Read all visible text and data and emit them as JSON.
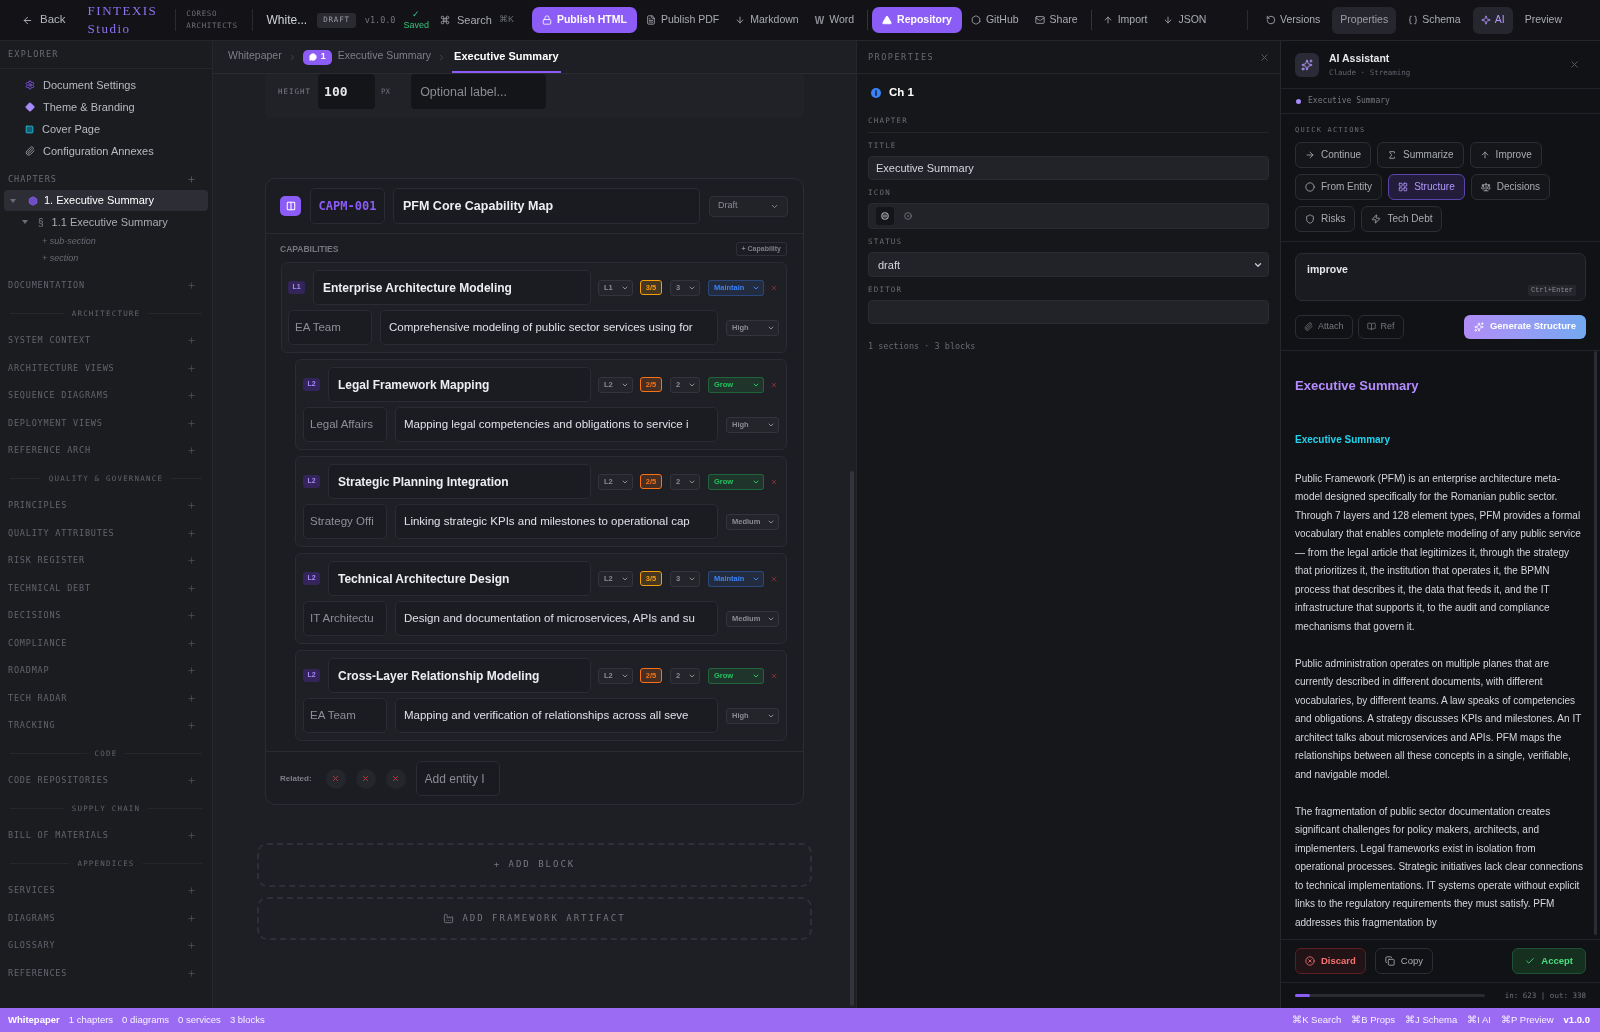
{
  "top_bar": {
    "back": "Back",
    "logo": {
      "line_1": "FINTEXIS",
      "line_2": "Studio"
    },
    "organization": {
      "line_1": "CORESO",
      "line_2": "ARCHITECTS"
    },
    "document": {
      "name": "White...",
      "status": "DRAFT",
      "version": "v1.0.0",
      "saved_mark": "✓",
      "saved": "Saved"
    },
    "search": {
      "label": "Search",
      "shortcut": "⌘K"
    },
    "actions": [
      {
        "kind": "primary",
        "label": "Publish HTML",
        "separator_before": false
      },
      {
        "kind": "plain",
        "label": "Publish PDF",
        "separator_before": false
      },
      {
        "kind": "plain",
        "label": "Markdown",
        "separator_before": false
      },
      {
        "kind": "plain",
        "glyph": "W",
        "label": "Word",
        "separator_before": false
      },
      {
        "kind": "primary",
        "label": "Repository",
        "separator_before": true
      },
      {
        "kind": "plain",
        "label": "GitHub",
        "separator_before": false
      },
      {
        "kind": "plain",
        "label": "Share",
        "separator_before": false
      },
      {
        "kind": "plain",
        "label": "Import",
        "separator_before": true
      },
      {
        "kind": "plain",
        "label": "JSON",
        "separator_before": false
      }
    ],
    "panels": [
      {
        "label": "Versions",
        "selected": false
      },
      {
        "label": "Properties",
        "selected": true
      },
      {
        "label": "Schema",
        "selected": false
      },
      {
        "label": "AI",
        "selected": true,
        "color": "#b197fc"
      },
      {
        "label": "Preview",
        "selected": false
      }
    ]
  },
  "sidebar": {
    "title": "EXPLORER",
    "document_items": [
      "Document Settings",
      "Theme & Branding",
      "Cover Page",
      "Configuration Annexes"
    ],
    "chapters": {
      "title": "CHAPTERS",
      "items": [
        {
          "label": "1. Executive Summary",
          "selected": true,
          "expanded": true,
          "children": [
            {
              "marker": "§",
              "label": "1.1 Executive Summary",
              "selected": false,
              "expanded": true
            }
          ]
        }
      ],
      "add_links": [
        "+ sub-section",
        "+ section"
      ]
    },
    "groups": [
      {
        "items": [
          "DOCUMENTATION"
        ]
      },
      {
        "heading": "ARCHITECTURE",
        "items": [
          "SYSTEM CONTEXT",
          "ARCHITECTURE VIEWS",
          "SEQUENCE DIAGRAMS",
          "DEPLOYMENT VIEWS",
          "REFERENCE ARCH"
        ]
      },
      {
        "heading": "QUALITY & GOVERNANCE",
        "items": [
          "PRINCIPLES",
          "QUALITY ATTRIBUTES",
          "RISK REGISTER",
          "TECHNICAL DEBT",
          "DECISIONS",
          "COMPLIANCE",
          "ROADMAP",
          "TECH RADAR",
          "TRACKING"
        ]
      },
      {
        "heading": "CODE",
        "items": [
          "CODE REPOSITORIES"
        ]
      },
      {
        "heading": "SUPPLY CHAIN",
        "items": [
          "BILL OF MATERIALS"
        ]
      },
      {
        "heading": "APPENDICES",
        "items": [
          "SERVICES",
          "DIAGRAMS",
          "GLOSSARY",
          "REFERENCES"
        ]
      }
    ]
  },
  "editor": {
    "breadcrumb": [
      {
        "label": "Whitepaper",
        "selected": false
      },
      {
        "badge": "1",
        "label": "Executive Summary",
        "selected": false
      },
      {
        "label": "Executive Summary",
        "selected": true
      }
    ],
    "height_block": {
      "label": "HEIGHT",
      "value": "100",
      "unit": "PX",
      "placeholder": "Optional label..."
    },
    "capability_map": {
      "id": "CAPM-001",
      "title": "PFM Core Capability Map",
      "status": "Draft",
      "section_label": "CAPABILITIES",
      "add_button": "+ Capability",
      "capabilities": [
        {
          "badge": "L1",
          "name": "Enterprise Architecture Modeling",
          "level": "L1",
          "maturity": {
            "value": "3/5",
            "color": "#f59e0b"
          },
          "target": "3",
          "strategy": {
            "value": "Maintain",
            "color": "#3b82f6"
          },
          "owner": "EA Team",
          "description": "Comprehensive modeling of public sector services using for",
          "priority": "High",
          "children": [
            {
              "badge": "L2",
              "name": "Legal Framework Mapping",
              "level": "L2",
              "maturity": {
                "value": "2/5",
                "color": "#f97316"
              },
              "target": "2",
              "strategy": {
                "value": "Grow",
                "color": "#22c55e"
              },
              "owner": "Legal Affairs",
              "description": "Mapping legal competencies and obligations to service i",
              "priority": "High"
            },
            {
              "badge": "L2",
              "name": "Strategic Planning Integration",
              "level": "L2",
              "maturity": {
                "value": "2/5",
                "color": "#f97316"
              },
              "target": "2",
              "strategy": {
                "value": "Grow",
                "color": "#22c55e"
              },
              "owner": "Strategy Offi",
              "description": "Linking strategic KPIs and milestones to operational cap",
              "priority": "Medium"
            },
            {
              "badge": "L2",
              "name": "Technical Architecture Design",
              "level": "L2",
              "maturity": {
                "value": "3/5",
                "color": "#f59e0b"
              },
              "target": "3",
              "strategy": {
                "value": "Maintain",
                "color": "#3b82f6"
              },
              "owner": "IT Architectu",
              "description": "Design and documentation of microservices, APIs and su",
              "priority": "Medium"
            },
            {
              "badge": "L2",
              "name": "Cross-Layer Relationship Modeling",
              "level": "L2",
              "maturity": {
                "value": "2/5",
                "color": "#f97316"
              },
              "target": "2",
              "strategy": {
                "value": "Grow",
                "color": "#22c55e"
              },
              "owner": "EA Team",
              "description": "Mapping and verification of relationships across all seve",
              "priority": "High"
            }
          ]
        }
      ],
      "related": {
        "label": "Related:",
        "items": [
          {
            "removable": true
          },
          {
            "removable": true
          },
          {
            "removable": true
          }
        ],
        "placeholder": "Add entity I"
      }
    },
    "add_block": "+ ADD BLOCK",
    "add_artifact": "ADD FRAMEWORK ARTIFACT"
  },
  "properties": {
    "title": "PROPERTIES",
    "heading": "Ch 1",
    "section": "CHAPTER",
    "fields": [
      {
        "kind": "text",
        "label": "TITLE",
        "value": "Executive Summary"
      },
      {
        "kind": "icon",
        "label": "ICON"
      },
      {
        "kind": "select",
        "label": "STATUS",
        "value": "draft"
      },
      {
        "kind": "text",
        "label": "EDITOR"
      }
    ],
    "summary": "1 sections · 3 blocks"
  },
  "ai_panel": {
    "title": "AI Assistant",
    "subtitle": "Claude · Streaming",
    "context": "Executive Summary",
    "quick_actions_label": "QUICK ACTIONS",
    "quick_actions": [
      {
        "label": "Continue",
        "selected": false
      },
      {
        "label": "Summarize",
        "selected": false
      },
      {
        "label": "Improve",
        "selected": false
      },
      {
        "label": "From Entity",
        "selected": false
      },
      {
        "label": "Structure",
        "selected": true
      },
      {
        "label": "Decisions",
        "selected": false
      },
      {
        "label": "Risks",
        "selected": false
      },
      {
        "label": "Tech Debt",
        "selected": false
      }
    ],
    "prompt": {
      "value": "improve",
      "hint": "Ctrl+Enter"
    },
    "attach": "Attach",
    "ref": "Ref",
    "generate": "Generate Structure",
    "output": {
      "title": "Executive Summary",
      "subtitle": "Executive Summary",
      "paragraphs": [
        "Public Framework (PFM) is an enterprise architecture meta-model designed specifically for the Romanian public sector. Through 7 layers and 128 element types, PFM provides a formal vocabulary that enables complete modeling of any public service — from the legal article that legitimizes it, through the strategy that prioritizes it, the institution that operates it, the BPMN process that describes it, the data that feeds it, and the IT infrastructure that supports it, to the audit and compliance mechanisms that govern it.",
        "Public administration operates on multiple planes that are currently described in different documents, with different vocabularies, by different teams. A law speaks of competencies and obligations. A strategy discusses KPIs and milestones. An IT architect talks about microservices and APIs. PFM maps the relationships between all these concepts in a single, verifiable, and navigable model.",
        "The fragmentation of public sector documentation creates significant challenges for policy makers, architects, and implementers. Legal frameworks exist in isolation from operational processes. Strategic initiatives lack clear connections to technical implementations. IT systems operate without explicit links to the regulatory requirements they must satisfy. PFM addresses this fragmentation by"
      ]
    },
    "footer": {
      "discard": "Discard",
      "copy": "Copy",
      "accept": "Accept"
    },
    "usage": {
      "level": 0.08,
      "text": "in: 623 | out: 338"
    }
  },
  "status_bar": {
    "document": "Whitepaper",
    "counts": [
      "1 chapters",
      "0 diagrams",
      "0 services",
      "3 blocks"
    ],
    "shortcuts": [
      "⌘K Search",
      "⌘B Props",
      "⌘J Schema",
      "⌘I AI",
      "⌘P Preview"
    ],
    "version": "v1.0.0"
  }
}
